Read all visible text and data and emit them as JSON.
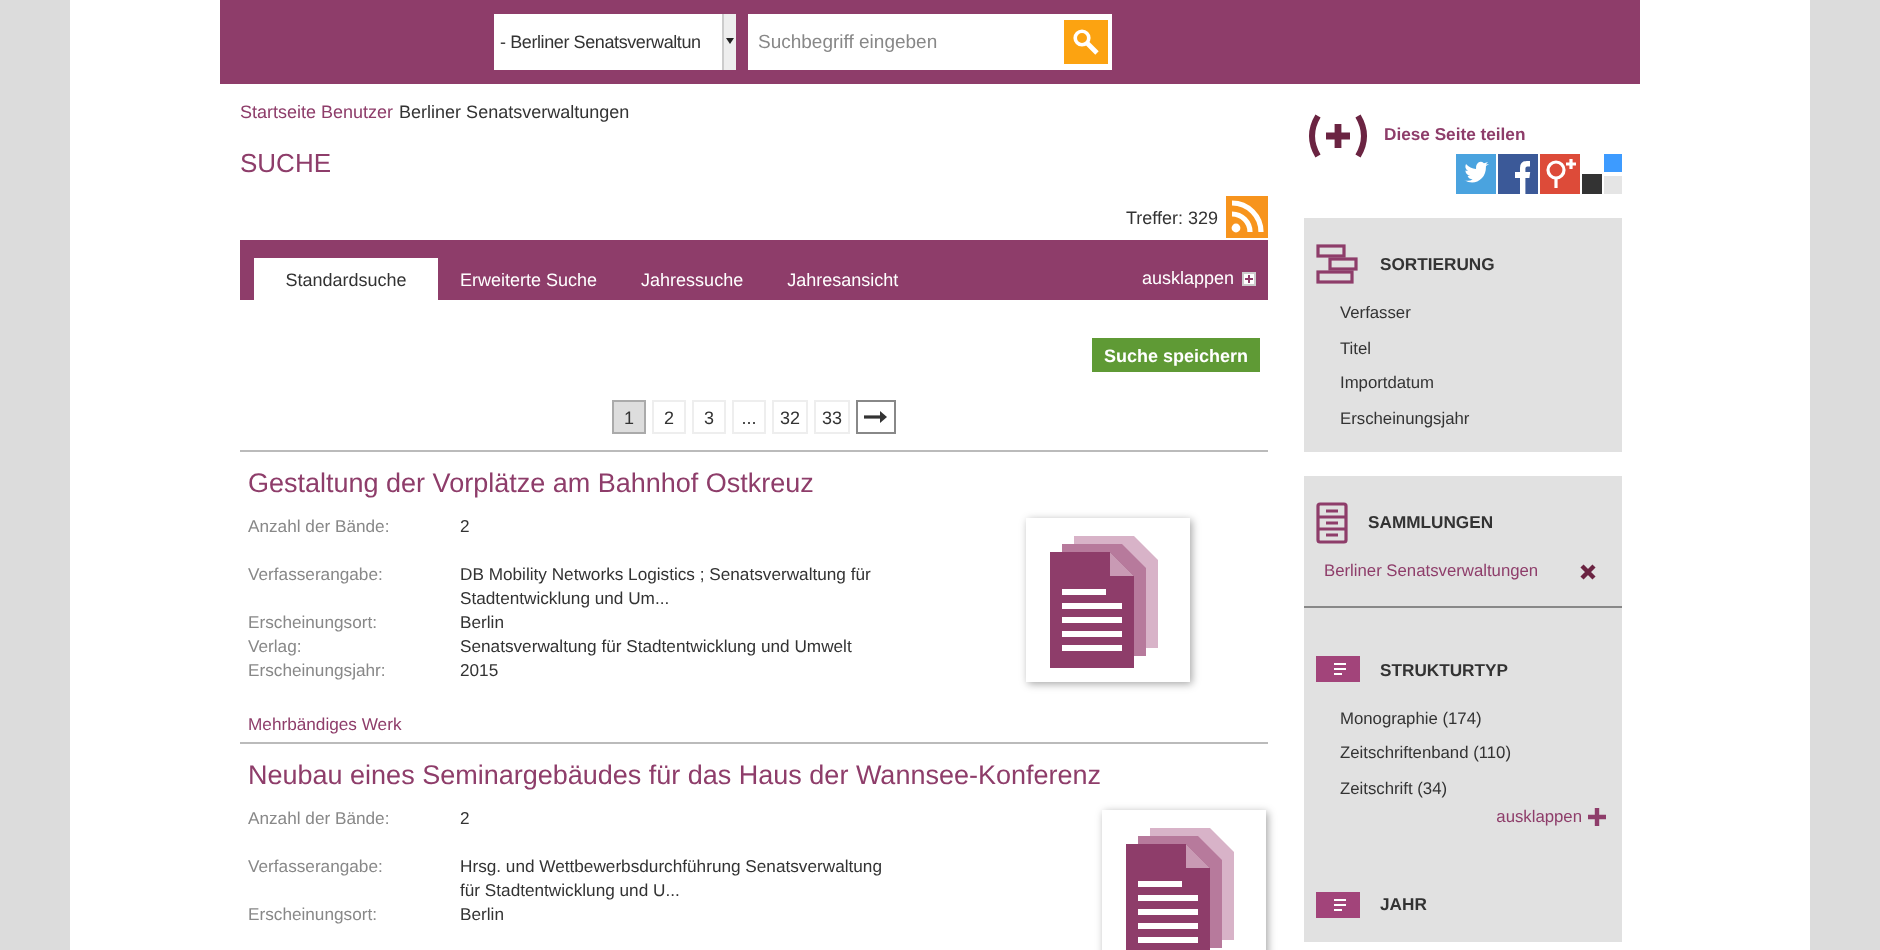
{
  "header": {
    "collection_select": "- Berliner Senatsverwaltun",
    "search": {
      "placeholder": "Suchbegriff eingeben"
    }
  },
  "breadcrumb": [
    {
      "label": "Startseite Benutzer",
      "kind": "link"
    },
    {
      "label": "Berliner Senatsverwaltungen",
      "kind": "current"
    }
  ],
  "page_title": "SUCHE",
  "hits": "Treffer: 329",
  "tabs": [
    {
      "label": "Standardsuche",
      "selected": true
    },
    {
      "label": "Erweiterte Suche",
      "selected": false
    },
    {
      "label": "Jahressuche",
      "selected": false
    },
    {
      "label": "Jahresansicht",
      "selected": false
    }
  ],
  "tabs_expand": "ausklappen",
  "save_button": "Suche speichern",
  "pagination": [
    {
      "label": "1",
      "selected": true
    },
    {
      "label": "2",
      "selected": false
    },
    {
      "label": "3",
      "selected": false
    },
    {
      "label": "...",
      "selected": false
    },
    {
      "label": "32",
      "selected": false
    },
    {
      "label": "33",
      "selected": false
    }
  ],
  "results": [
    {
      "title": "Gestaltung der Vorplätze am Bahnhof Ostkreuz",
      "fields": [
        {
          "label": "Anzahl der Bände:",
          "value": "2"
        },
        {
          "label": "Verfasserangabe:",
          "value": "DB Mobility Networks Logistics ; Senatsverwaltung für Stadtentwicklung und Um..."
        },
        {
          "label": "Erscheinungsort:",
          "value": "Berlin"
        },
        {
          "label": "Verlag:",
          "value": "Senatsverwaltung für Stadtentwicklung und Umwelt"
        },
        {
          "label": "Erscheinungsjahr:",
          "value": "2015"
        }
      ],
      "footer": "Mehrbändiges Werk"
    },
    {
      "title": "Neubau eines Seminargebäudes für das Haus der Wannsee-Konferenz",
      "fields": [
        {
          "label": "Anzahl der Bände:",
          "value": "2"
        },
        {
          "label": "Verfasserangabe:",
          "value": "Hrsg. und Wettbewerbsdurchführung Senatsverwaltung für Stadtentwicklung und U..."
        },
        {
          "label": "Erscheinungsort:",
          "value": "Berlin"
        }
      ]
    }
  ],
  "share": {
    "label": "Diese Seite teilen"
  },
  "sidebar": [
    {
      "kind": "sort",
      "title": "SORTIERUNG",
      "items": [
        {
          "label": "Verfasser"
        },
        {
          "label": "Titel"
        },
        {
          "label": "Importdatum"
        },
        {
          "label": "Erscheinungsjahr"
        }
      ]
    },
    {
      "kind": "collection",
      "title": "SAMMLUNGEN",
      "items": [
        {
          "label": "Berliner Senatsverwaltungen",
          "removable": true
        }
      ]
    },
    {
      "kind": "facet",
      "title": "STRUKTURTYP",
      "items": [
        {
          "label": "Monographie (174)"
        },
        {
          "label": "Zeitschriftenband (110)"
        },
        {
          "label": "Zeitschrift (34)"
        }
      ],
      "more": "ausklappen"
    },
    {
      "kind": "facet",
      "title": "JAHR"
    }
  ]
}
